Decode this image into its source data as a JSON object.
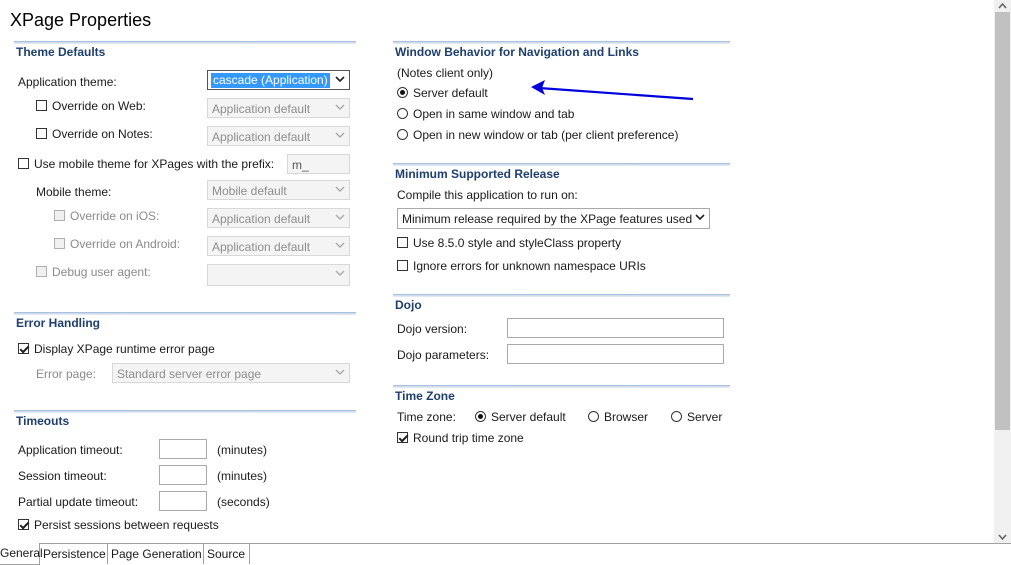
{
  "window": {
    "title": "XPage Properties"
  },
  "theme_defaults": {
    "header": "Theme Defaults",
    "app_theme_label": "Application theme:",
    "app_theme_value": "cascade (Application)",
    "override_web_label": "Override on Web:",
    "override_web_value": "Application default",
    "override_notes_label": "Override on Notes:",
    "override_notes_value": "Application default",
    "mobile_prefix_label": "Use mobile theme for XPages with the prefix:",
    "mobile_prefix_value": "m_",
    "mobile_theme_label": "Mobile theme:",
    "mobile_theme_value": "Mobile default",
    "override_ios_label": "Override on iOS:",
    "override_ios_value": "Application default",
    "override_android_label": "Override on Android:",
    "override_android_value": "Application default",
    "debug_agent_label": "Debug user agent:",
    "debug_agent_value": ""
  },
  "error_handling": {
    "header": "Error Handling",
    "display_error_label": "Display XPage runtime error page",
    "error_page_label": "Error page:",
    "error_page_value": "Standard server error page"
  },
  "timeouts": {
    "header": "Timeouts",
    "app_timeout_label": "Application timeout:",
    "app_timeout_unit": "(minutes)",
    "session_timeout_label": "Session timeout:",
    "session_timeout_unit": "(minutes)",
    "partial_timeout_label": "Partial update timeout:",
    "partial_timeout_unit": "(seconds)",
    "persist_label": "Persist sessions between requests"
  },
  "window_behavior": {
    "header": "Window Behavior for Navigation and Links",
    "note": "(Notes client only)",
    "opt_server": "Server default",
    "opt_same": "Open in same window and tab",
    "opt_new": "Open in new window or tab (per client preference)"
  },
  "min_release": {
    "header": "Minimum Supported Release",
    "compile_label": "Compile this application to run on:",
    "compile_value": "Minimum release required by the XPage features used",
    "style850_label": "Use 8.5.0 style and styleClass property",
    "ignore_ns_label": "Ignore errors for unknown namespace URIs"
  },
  "dojo": {
    "header": "Dojo",
    "version_label": "Dojo version:",
    "version_value": "",
    "params_label": "Dojo parameters:",
    "params_value": ""
  },
  "time_zone": {
    "header": "Time Zone",
    "label": "Time zone:",
    "opt_server_default": "Server default",
    "opt_browser": "Browser",
    "opt_server": "Server",
    "round_trip_label": "Round trip time zone"
  },
  "tabs": [
    {
      "label": "General"
    },
    {
      "label": "Persistence"
    },
    {
      "label": "Page Generation"
    },
    {
      "label": "Source"
    }
  ],
  "colors": {
    "section_header": "#1e3f6e",
    "annotation_arrow": "#0000dd",
    "selection": "#3399ff"
  }
}
